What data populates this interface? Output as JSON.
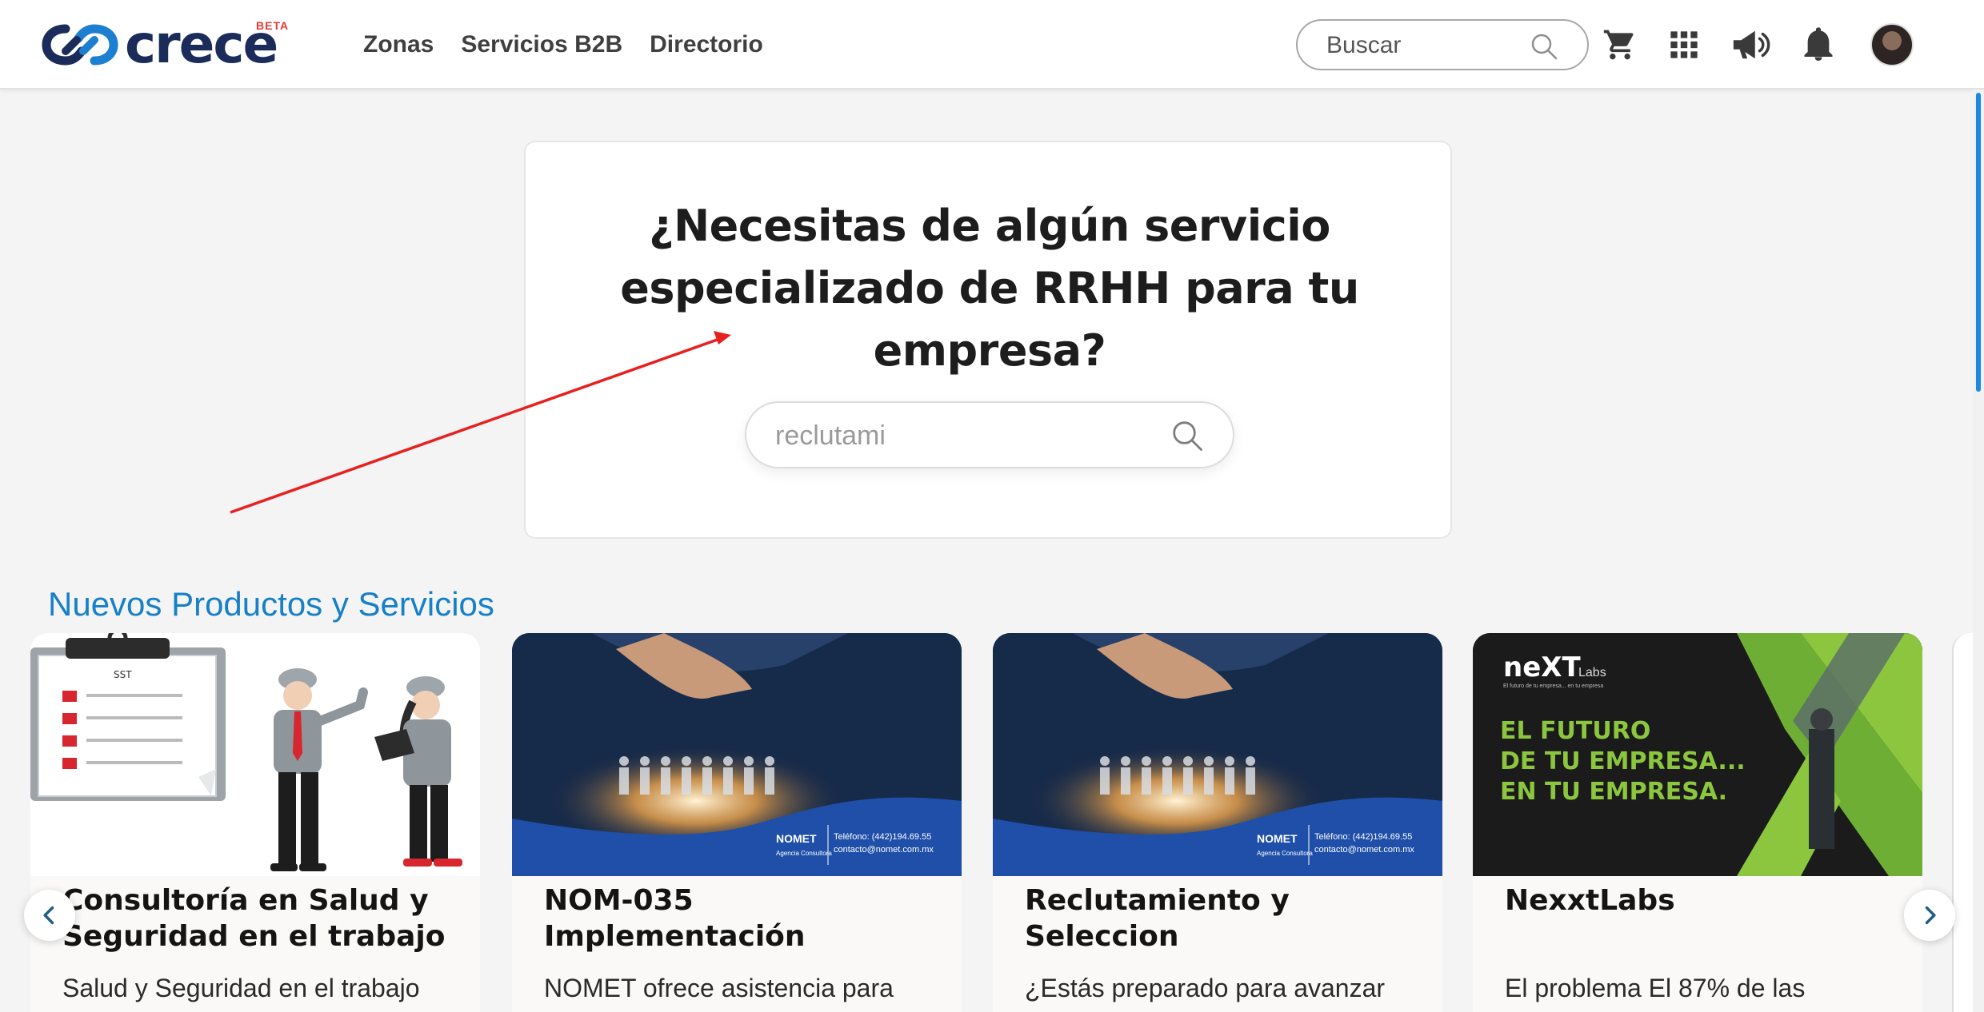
{
  "header": {
    "logo_text": "crece",
    "logo_badge": "BETA",
    "nav": [
      {
        "label": "Zonas"
      },
      {
        "label": "Servicios B2B"
      },
      {
        "label": "Directorio"
      }
    ],
    "search": {
      "placeholder": "Buscar"
    },
    "icons": [
      "cart-icon",
      "apps-grid-icon",
      "megaphone-icon",
      "bell-icon",
      "avatar"
    ]
  },
  "hero": {
    "title": "¿Necesitas de algún servicio especializado de RRHH para tu empresa?",
    "search_value": "reclutami"
  },
  "products": {
    "section_title": "Nuevos Productos y Servicios",
    "cards": [
      {
        "title": "Consultoría en Salud y Seguridad en el trabajo",
        "description": "Salud y Seguridad en el trabajo",
        "image": "Consultoría en Salud y Seguridad en el trabajo",
        "image_text": "SST"
      },
      {
        "title": "NOM-035 Implementación",
        "description": "NOMET ofrece asistencia para",
        "image": "NOMET",
        "image_text": {
          "brand": "NOMET",
          "sub": "Agencia Consultora",
          "phone": "Teléfono: (442)194.69.55",
          "email": "contacto@nomet.com.mx"
        }
      },
      {
        "title": "Reclutamiento y Seleccion",
        "description": "¿Estás preparado para avanzar",
        "image": "NOMET",
        "image_text": {
          "brand": "NOMET",
          "sub": "Agencia Consultora",
          "phone": "Teléfono: (442)194.69.55",
          "email": "contacto@nomet.com.mx"
        }
      },
      {
        "title": "NexxtLabs",
        "description": "El problema El 87% de las",
        "image": "NexxtLabs",
        "image_text": {
          "logo": "neXT",
          "logo_sub": "Labs",
          "tagline": "El futuro de tu empresa... en tu empresa",
          "line1": "EL FUTURO",
          "line2": "DE TU EMPRESA...",
          "line3": "EN TU EMPRESA."
        }
      }
    ]
  },
  "colors": {
    "accent_blue": "#1780c6",
    "brand_navy": "#1b2c5a",
    "nomet_blue": "#1f4fa8",
    "nexxt_green": "#8cc63f",
    "annotation_red": "#e82020"
  }
}
